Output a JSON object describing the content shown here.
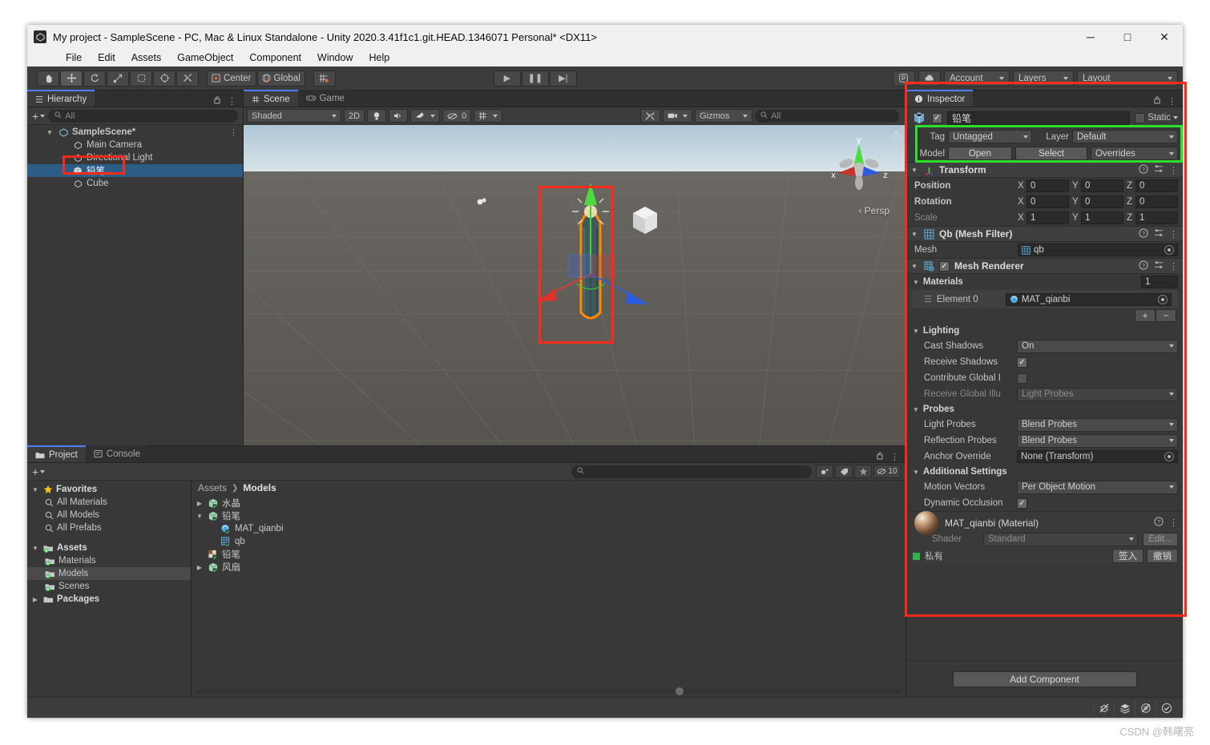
{
  "window": {
    "title": "My project - SampleScene - PC, Mac & Linux Standalone - Unity 2020.3.41f1c1.git.HEAD.1346071 Personal* <DX11>",
    "minimize": "─",
    "maximize": "□",
    "close": "✕"
  },
  "menubar": {
    "items": [
      "File",
      "Edit",
      "Assets",
      "GameObject",
      "Component",
      "Window",
      "Help"
    ]
  },
  "toolbar": {
    "tools": [
      {
        "name": "hand-tool",
        "glyph": "✋"
      },
      {
        "name": "move-tool",
        "glyph": "✥"
      },
      {
        "name": "rotate-tool",
        "glyph": "↺"
      },
      {
        "name": "scale-tool",
        "glyph": "↗"
      },
      {
        "name": "rect-tool",
        "glyph": "⬚"
      },
      {
        "name": "transform-tool",
        "glyph": "⬡"
      },
      {
        "name": "custom-tool",
        "glyph": "⚒"
      }
    ],
    "pivot_label": "Center",
    "handle_label": "Global",
    "snap_label": "⌗",
    "play": "▶",
    "pause": "❚❚",
    "step": "▶|",
    "collab_label": "Ⓟ",
    "cloud_label": "☁",
    "account_label": "Account",
    "layers_label": "Layers",
    "layout_label": "Layout"
  },
  "hierarchy": {
    "tab_label": "Hierarchy",
    "search_placeholder": "All",
    "add_label": "+",
    "items": [
      {
        "label": "SampleScene*",
        "depth": 0,
        "icon": "scene-icon",
        "expanded": true,
        "selected": false,
        "bold": true
      },
      {
        "label": "Main Camera",
        "depth": 1,
        "icon": "gameobject-icon",
        "selected": false
      },
      {
        "label": "Directional Light",
        "depth": 1,
        "icon": "gameobject-icon",
        "selected": false
      },
      {
        "label": "铅笔",
        "depth": 1,
        "icon": "mesh-icon",
        "selected": true
      },
      {
        "label": "Cube",
        "depth": 1,
        "icon": "gameobject-icon",
        "selected": false
      }
    ]
  },
  "scene": {
    "tabs": [
      {
        "label": "Scene",
        "icon": "grid-icon",
        "active": true
      },
      {
        "label": "Game",
        "icon": "gamepad-icon",
        "active": false
      }
    ],
    "shading_mode": "Shaded",
    "mode_2d": "2D",
    "light_toggle": "Ὂ1",
    "audio_toggle": "🔈",
    "fx_toggle": "fx",
    "visibility_count": "0",
    "grid_label": "grid",
    "gizmos_label": "Gizmos",
    "search_placeholder": "All",
    "axis_labels": {
      "x": "x",
      "y": "y",
      "z": "z"
    },
    "projection_label": "‹ Persp"
  },
  "project": {
    "tabs": [
      {
        "label": "Project",
        "icon": "folder-icon",
        "active": true
      },
      {
        "label": "Console",
        "icon": "console-icon",
        "active": false
      }
    ],
    "add_label": "+",
    "search_placeholder": "",
    "item_count": "10",
    "tree": [
      {
        "label": "Favorites",
        "depth": 0,
        "icon": "star-icon",
        "expanded": true,
        "bold": true
      },
      {
        "label": "All Materials",
        "depth": 1,
        "icon": "search-icon"
      },
      {
        "label": "All Models",
        "depth": 1,
        "icon": "search-icon"
      },
      {
        "label": "All Prefabs",
        "depth": 1,
        "icon": "search-icon"
      },
      {
        "label": "Assets",
        "depth": 0,
        "icon": "folder-plus-icon",
        "expanded": true,
        "bold": true
      },
      {
        "label": "Materials",
        "depth": 1,
        "icon": "folder-plus-icon"
      },
      {
        "label": "Models",
        "depth": 1,
        "icon": "folder-plus-icon",
        "selected": true
      },
      {
        "label": "Scenes",
        "depth": 1,
        "icon": "folder-plus-icon"
      },
      {
        "label": "Packages",
        "depth": 0,
        "icon": "folder-icon",
        "expanded": false,
        "bold": true
      }
    ],
    "breadcrumb": [
      "Assets",
      "Models"
    ],
    "items": [
      {
        "label": "水晶",
        "depth": 0,
        "icon": "model-icon",
        "arrow": "▶"
      },
      {
        "label": "铅笔",
        "depth": 0,
        "icon": "model-icon",
        "arrow": "▼"
      },
      {
        "label": "MAT_qianbi",
        "depth": 1,
        "icon": "material-icon",
        "arrow": ""
      },
      {
        "label": "qb",
        "depth": 1,
        "icon": "mesh-icon",
        "arrow": ""
      },
      {
        "label": "铅笔",
        "depth": 0,
        "icon": "texture-icon",
        "arrow": ""
      },
      {
        "label": "风扇",
        "depth": 0,
        "icon": "model-icon",
        "arrow": "▶"
      }
    ]
  },
  "inspector": {
    "tab_label": "Inspector",
    "object_name": "铅笔",
    "static_label": "Static",
    "tag_label": "Tag",
    "tag_value": "Untagged",
    "layer_label": "Layer",
    "layer_value": "Default",
    "model_label": "Model",
    "open_label": "Open",
    "select_label": "Select",
    "overrides_label": "Overrides",
    "transform": {
      "title": "Transform",
      "rows": [
        {
          "label": "Position",
          "x": "0",
          "y": "0",
          "z": "0",
          "dim": false
        },
        {
          "label": "Rotation",
          "x": "0",
          "y": "0",
          "z": "0",
          "dim": false
        },
        {
          "label": "Scale",
          "x": "1",
          "y": "1",
          "z": "1",
          "dim": true
        }
      ]
    },
    "mesh_filter": {
      "title": "Qb (Mesh Filter)",
      "mesh_label": "Mesh",
      "mesh_value": "qb"
    },
    "mesh_renderer": {
      "title": "Mesh Renderer",
      "materials_label": "Materials",
      "materials_count": "1",
      "element_label": "Element 0",
      "element_value": "MAT_qianbi",
      "add_label": "+",
      "remove_label": "−",
      "lighting_label": "Lighting",
      "cast_shadows_label": "Cast Shadows",
      "cast_shadows_value": "On",
      "receive_shadows_label": "Receive Shadows",
      "contribute_gi_label": "Contribute Global I",
      "receive_gi_label": "Receive Global Illu",
      "receive_gi_value": "Light Probes",
      "probes_label": "Probes",
      "light_probes_label": "Light Probes",
      "light_probes_value": "Blend Probes",
      "reflection_probes_label": "Reflection Probes",
      "reflection_probes_value": "Blend Probes",
      "anchor_override_label": "Anchor Override",
      "anchor_override_value": "None (Transform)",
      "additional_settings_label": "Additional Settings",
      "motion_vectors_label": "Motion Vectors",
      "motion_vectors_value": "Per Object Motion",
      "dynamic_occlusion_label": "Dynamic Occlusion"
    },
    "material": {
      "title": "MAT_qianbi (Material)",
      "shader_label": "Shader",
      "shader_value": "Standard",
      "edit_label": "Edit...",
      "private_label": "私有",
      "checkin_label": "签入",
      "revert_label": "撤销"
    },
    "add_component_label": "Add Component"
  },
  "statusbar": {
    "icons": [
      "bug-off-icon",
      "layers-icon",
      "eye-off-icon",
      "check-circle-icon"
    ]
  },
  "watermark": "CSDN @韩曙亮",
  "colors": {
    "accent_blue": "#4c7eff",
    "selection_blue": "#2c5d87",
    "annotation_red": "#fb2b1c",
    "annotation_green": "#2ae02a",
    "panel_bg": "#383838",
    "header_bg": "#3c3c3c"
  }
}
